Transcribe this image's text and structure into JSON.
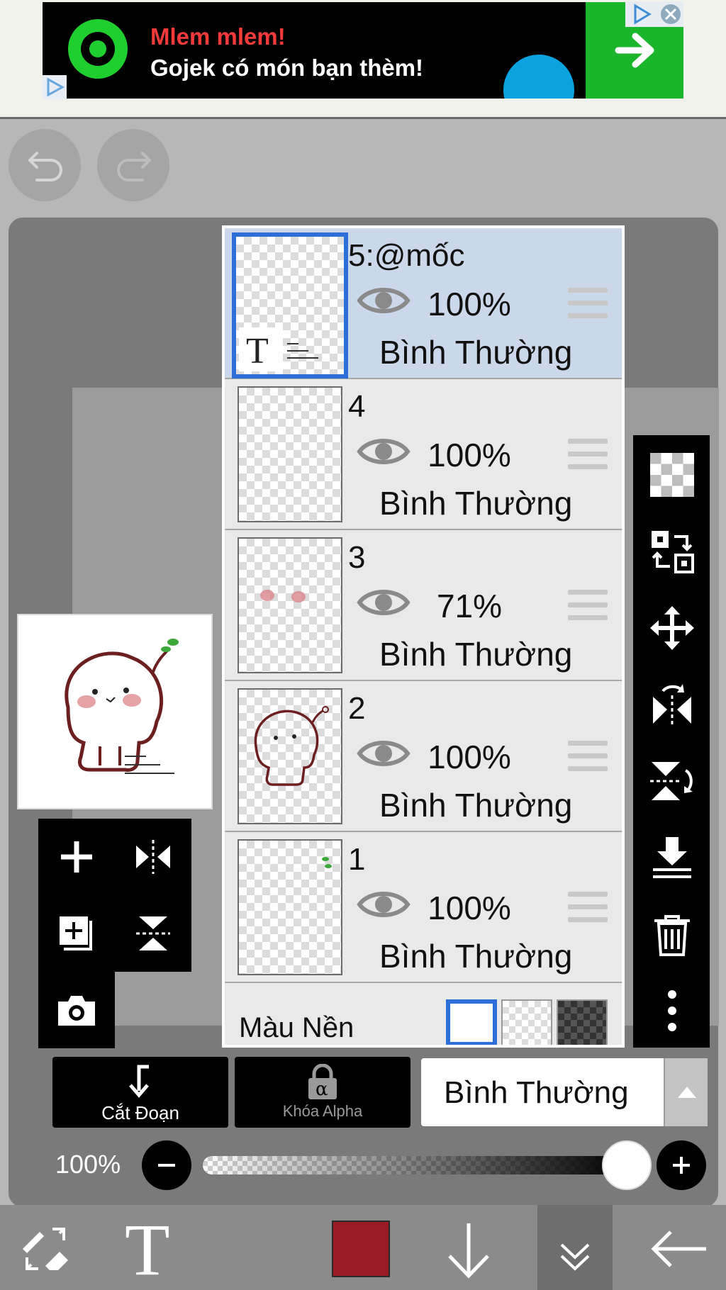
{
  "ad": {
    "headline": "Mlem mlem!",
    "subline": "Gojek có món bạn thèm!",
    "colors": {
      "logo": "#1fcf30",
      "headline": "#f23a3a",
      "cta": "#1ab52a"
    }
  },
  "layers": [
    {
      "name": "5:@mốc",
      "opacity": "100%",
      "blend": "Bình Thường",
      "selected": true
    },
    {
      "name": "4",
      "opacity": "100%",
      "blend": "Bình Thường",
      "selected": false
    },
    {
      "name": "3",
      "opacity": "71%",
      "blend": "Bình Thường",
      "selected": false
    },
    {
      "name": "2",
      "opacity": "100%",
      "blend": "Bình Thường",
      "selected": false
    },
    {
      "name": "1",
      "opacity": "100%",
      "blend": "Bình Thường",
      "selected": false
    }
  ],
  "thumb_text": {
    "t_glyph": "T"
  },
  "background_row": {
    "label": "Màu Nền",
    "selected": "white"
  },
  "clipping": {
    "label": "Cắt Đoạn"
  },
  "alpha_lock": {
    "label": "Khóa Alpha",
    "glyph": "α"
  },
  "blend_mode": {
    "value": "Bình Thường"
  },
  "opacity": {
    "value_text": "100%",
    "fraction": 1.0
  },
  "current_color": "#9b1b22",
  "icons": {
    "top": [
      "undo-icon",
      "redo-icon"
    ],
    "left_tools": [
      "add-layer-icon",
      "flip-horizontal-icon",
      "duplicate-layer-icon",
      "flip-vertical-icon",
      "camera-icon"
    ],
    "right_tools": [
      "transparency-icon",
      "swap-layers-icon",
      "move-icon",
      "flip-horizontal-icon",
      "flip-vertical-icon",
      "merge-down-icon",
      "trash-icon",
      "more-icon"
    ],
    "bottom": [
      "pen-eraser-icon",
      "text-tool-icon",
      "color-swatch",
      "arrow-down-icon",
      "collapse-icon",
      "back-arrow-icon"
    ]
  },
  "bottom_bar": {
    "text_tool_glyph": "T"
  }
}
